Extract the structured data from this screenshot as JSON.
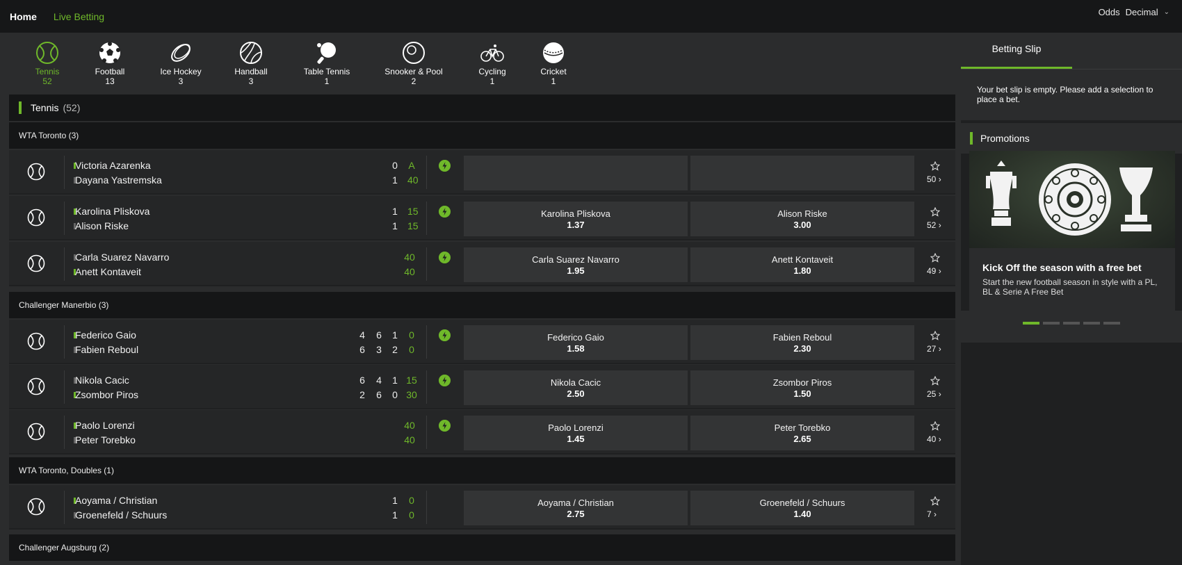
{
  "nav": {
    "home": "Home",
    "live": "Live Betting",
    "odds_label": "Odds",
    "odds_value": "Decimal"
  },
  "sports": [
    {
      "name": "Tennis",
      "count": "52",
      "icon": "tennis-ball-icon"
    },
    {
      "name": "Football",
      "count": "13",
      "icon": "football-icon"
    },
    {
      "name": "Ice Hockey",
      "count": "3",
      "icon": "puck-icon"
    },
    {
      "name": "Handball",
      "count": "3",
      "icon": "handball-icon"
    },
    {
      "name": "Table Tennis",
      "count": "1",
      "icon": "paddle-icon"
    },
    {
      "name": "Snooker & Pool",
      "count": "2",
      "icon": "snooker-ball-icon"
    },
    {
      "name": "Cycling",
      "count": "1",
      "icon": "bicycle-icon"
    },
    {
      "name": "Cricket",
      "count": "1",
      "icon": "cricket-ball-icon"
    }
  ],
  "section": {
    "title": "Tennis",
    "count": "(52)"
  },
  "competitions": {
    "c1": "WTA Toronto (3)",
    "c2": "Challenger Manerbio (3)",
    "c3": "WTA Toronto, Doubles (1)",
    "c4": "Challenger Augsburg (2)"
  },
  "matches": [
    {
      "p1": "Victoria Azarenka",
      "p2": "Dayana Yastremska",
      "s1": [
        "0",
        "A"
      ],
      "s2": [
        "1",
        "40"
      ],
      "o1n": "",
      "o1v": "",
      "o2n": "",
      "o2v": "",
      "more": "50"
    },
    {
      "p1": "Karolina Pliskova",
      "p2": "Alison Riske",
      "s1": [
        "1",
        "15"
      ],
      "s2": [
        "1",
        "15"
      ],
      "o1n": "Karolina Pliskova",
      "o1v": "1.37",
      "o2n": "Alison Riske",
      "o2v": "3.00",
      "more": "52"
    },
    {
      "p1": "Carla Suarez Navarro",
      "p2": "Anett Kontaveit",
      "s1": [
        "40"
      ],
      "s2": [
        "40"
      ],
      "o1n": "Carla Suarez Navarro",
      "o1v": "1.95",
      "o2n": "Anett Kontaveit",
      "o2v": "1.80",
      "more": "49"
    },
    {
      "p1": "Federico Gaio",
      "p2": "Fabien Reboul",
      "s1": [
        "4",
        "6",
        "1",
        "0"
      ],
      "s2": [
        "6",
        "3",
        "2",
        "0"
      ],
      "o1n": "Federico Gaio",
      "o1v": "1.58",
      "o2n": "Fabien Reboul",
      "o2v": "2.30",
      "more": "27"
    },
    {
      "p1": "Nikola Cacic",
      "p2": "Zsombor Piros",
      "s1": [
        "6",
        "4",
        "1",
        "15"
      ],
      "s2": [
        "2",
        "6",
        "0",
        "30"
      ],
      "o1n": "Nikola Cacic",
      "o1v": "2.50",
      "o2n": "Zsombor Piros",
      "o2v": "1.50",
      "more": "25"
    },
    {
      "p1": "Paolo Lorenzi",
      "p2": "Peter Torebko",
      "s1": [
        "40"
      ],
      "s2": [
        "40"
      ],
      "o1n": "Paolo Lorenzi",
      "o1v": "1.45",
      "o2n": "Peter Torebko",
      "o2v": "2.65",
      "more": "40"
    },
    {
      "p1": "Aoyama / Christian",
      "p2": "Groenefeld / Schuurs",
      "s1": [
        "1",
        "0"
      ],
      "s2": [
        "1",
        "0"
      ],
      "o1n": "Aoyama / Christian",
      "o1v": "2.75",
      "o2n": "Groenefeld / Schuurs",
      "o2v": "1.40",
      "more": "7"
    }
  ],
  "slip": {
    "tab": "Betting Slip",
    "empty": "Your bet slip is empty. Please add a selection to place a bet."
  },
  "promo": {
    "title": "Promotions",
    "card_title": "Kick Off the season with a free bet",
    "card_desc": "Start the new football season in style with a PL, BL & Serie A Free Bet"
  },
  "colors": {
    "accent": "#6fb82a",
    "bg": "#1f2021",
    "panel": "#2b2c2d"
  }
}
